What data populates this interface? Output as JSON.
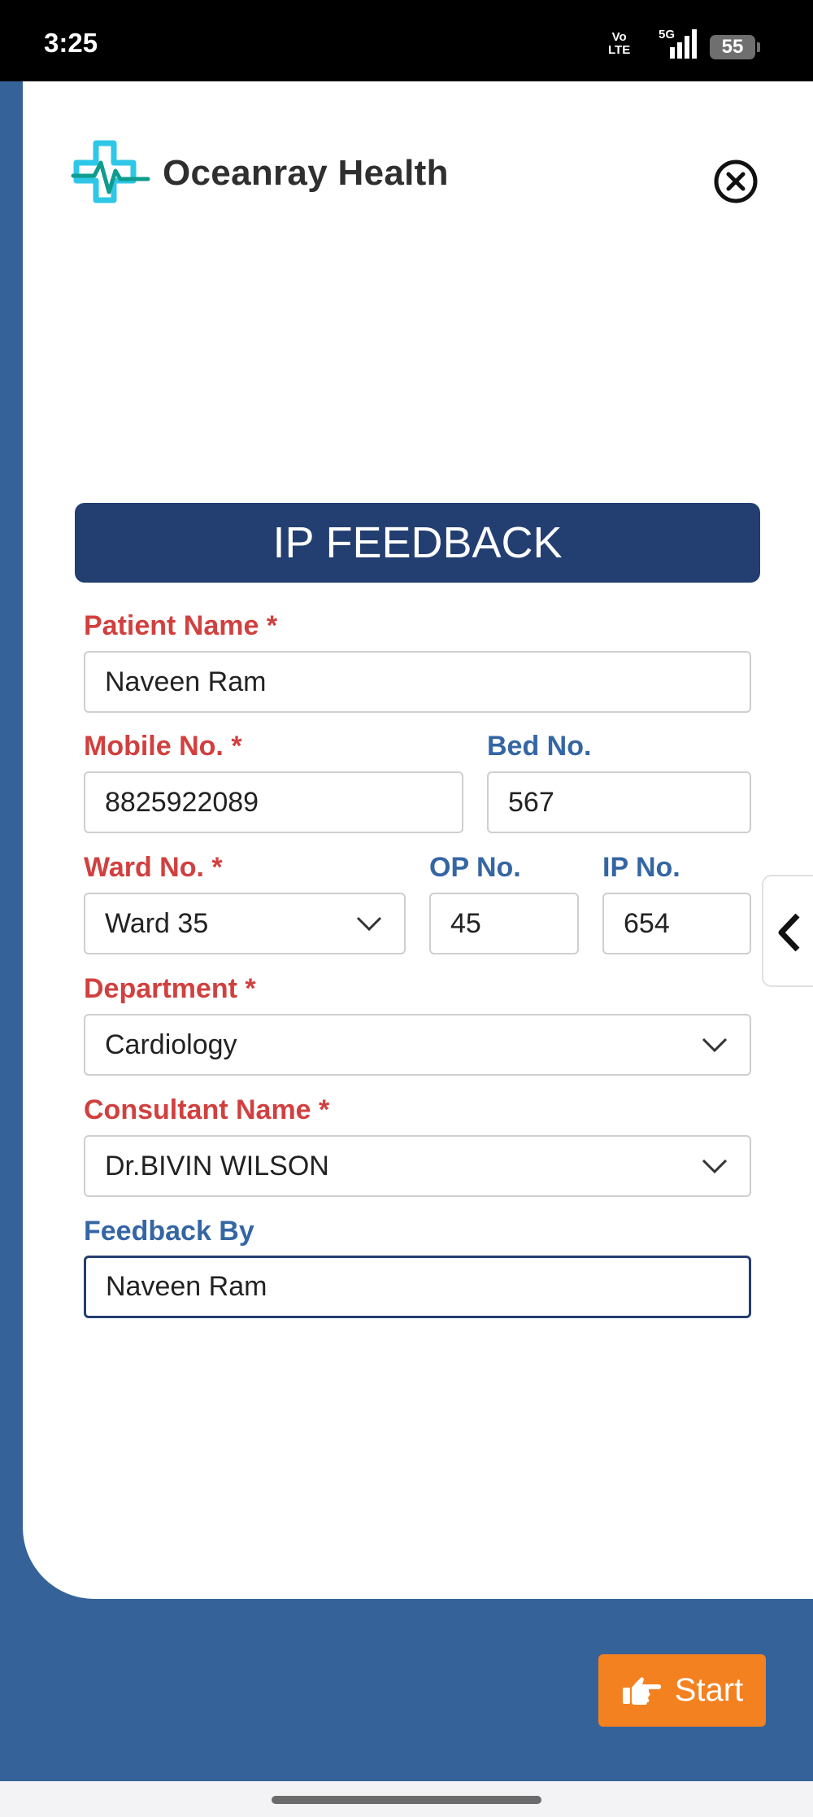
{
  "status": {
    "time": "3:25",
    "volte_top": "Vo",
    "volte_bottom": "LTE",
    "network": "5G",
    "battery": "55"
  },
  "app": {
    "brand": "Oceanray Health",
    "accent": "#233e70",
    "logo_colors": [
      "#2ec7e8",
      "#0e9c8e"
    ]
  },
  "form": {
    "title": "IP FEEDBACK",
    "patient_name": {
      "label": "Patient Name *",
      "value": "Naveen Ram"
    },
    "mobile": {
      "label": "Mobile No. *",
      "value": "8825922089"
    },
    "bed": {
      "label": "Bed No.",
      "value": "567"
    },
    "ward": {
      "label": "Ward No. *",
      "value": "Ward 35"
    },
    "op": {
      "label": "OP No.",
      "value": "45"
    },
    "ip": {
      "label": "IP No.",
      "value": "654"
    },
    "department": {
      "label": "Department *",
      "value": "Cardiology"
    },
    "consultant": {
      "label": "Consultant Name *",
      "value": "Dr.BIVIN WILSON"
    },
    "feedback_by": {
      "label": "Feedback By",
      "value": "Naveen Ram"
    }
  },
  "actions": {
    "start_label": "Start",
    "start_color": "#f48120"
  },
  "icons": {
    "close": "close-circle-icon",
    "chevron": "chevron-down-icon",
    "side": "chevron-left-icon",
    "start": "pointing-hand-icon"
  }
}
